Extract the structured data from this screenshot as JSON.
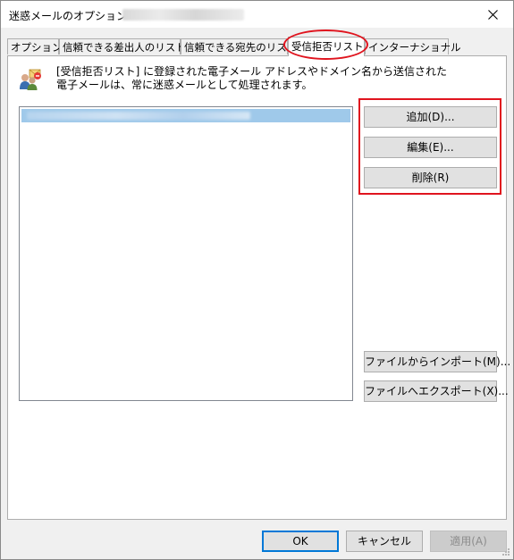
{
  "window": {
    "title": "迷惑メールのオプション -"
  },
  "tabs": [
    {
      "label": "オプション",
      "active": false
    },
    {
      "label": "信頼できる差出人のリスト",
      "active": false
    },
    {
      "label": "信頼できる宛先のリスト",
      "active": false
    },
    {
      "label": "受信拒否リスト",
      "active": true
    },
    {
      "label": "インターナショナル",
      "active": false
    }
  ],
  "panel": {
    "description_line1": "[受信拒否リスト] に登録された電子メール アドレスやドメイン名から送信された",
    "description_line2": "電子メールは、常に迷惑メールとして処理されます。",
    "buttons": {
      "add": "追加(D)...",
      "edit": "編集(E)...",
      "delete": "削除(R)",
      "import": "ファイルからインポート(M)...",
      "export": "ファイルへエクスポート(X)..."
    }
  },
  "footer": {
    "ok": "OK",
    "cancel": "キャンセル",
    "apply": "適用(A)"
  },
  "colors": {
    "highlight": "#e0141e",
    "selection": "#9fc9ea",
    "primary_border": "#0078d7"
  }
}
